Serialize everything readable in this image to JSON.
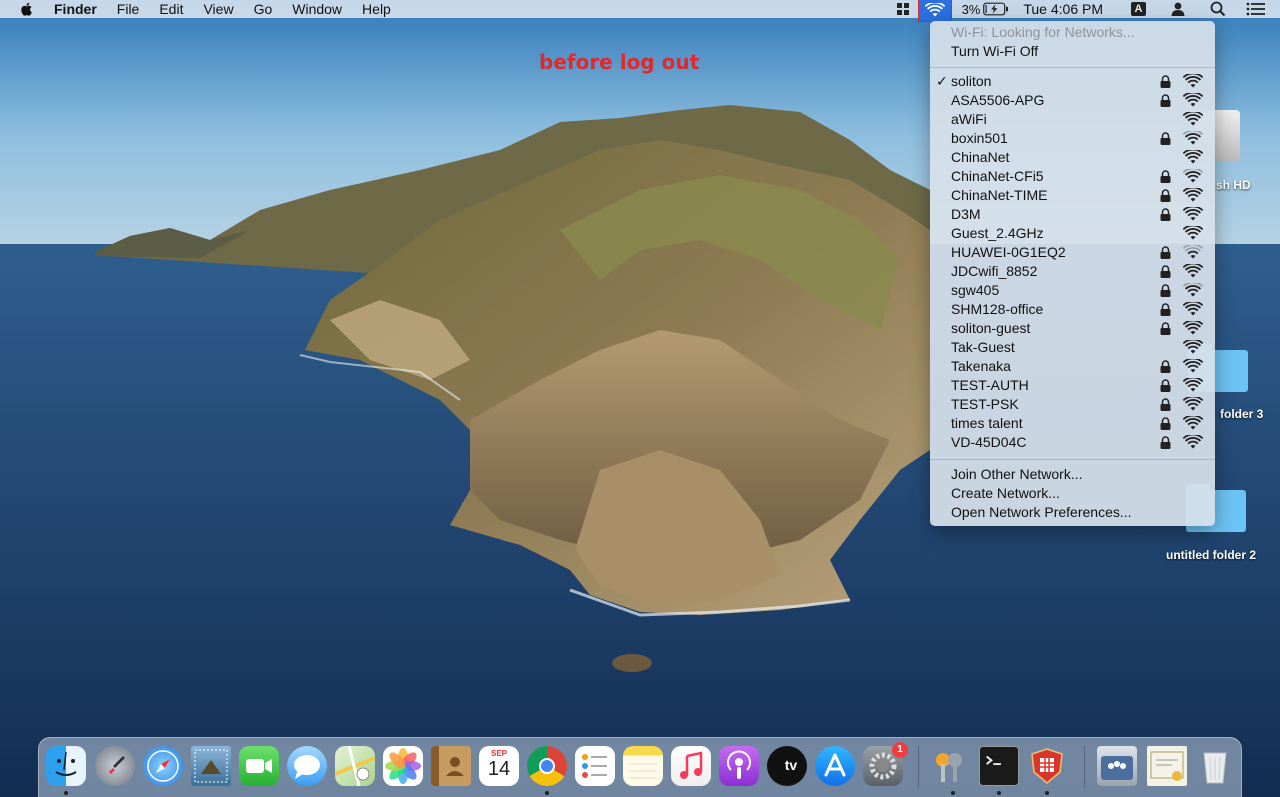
{
  "menubar": {
    "app_name": "Finder",
    "items": [
      "File",
      "Edit",
      "View",
      "Go",
      "Window",
      "Help"
    ],
    "battery_percent": "3%",
    "clock": "Tue 4:06 PM",
    "input_source": "A",
    "icons": [
      "apple-icon",
      "shortcut-icon",
      "wifi-icon",
      "battery-charging-icon",
      "input-source-icon",
      "user-icon",
      "spotlight-icon",
      "notification-center-icon"
    ]
  },
  "annotation": {
    "text": "before log out",
    "color": "#e0292c"
  },
  "wifi_menu": {
    "status": "Wi-Fi: Looking for Networks...",
    "toggle": "Turn Wi-Fi Off",
    "networks": [
      {
        "name": "soliton",
        "checked": true,
        "locked": true,
        "bars": 3
      },
      {
        "name": "ASA5506-APG",
        "checked": false,
        "locked": true,
        "bars": 3
      },
      {
        "name": "aWiFi",
        "checked": false,
        "locked": false,
        "bars": 3
      },
      {
        "name": "boxin501",
        "checked": false,
        "locked": true,
        "bars": 2
      },
      {
        "name": "ChinaNet",
        "checked": false,
        "locked": false,
        "bars": 3
      },
      {
        "name": "ChinaNet-CFi5",
        "checked": false,
        "locked": true,
        "bars": 2
      },
      {
        "name": "ChinaNet-TIME",
        "checked": false,
        "locked": true,
        "bars": 3
      },
      {
        "name": "D3M",
        "checked": false,
        "locked": true,
        "bars": 3
      },
      {
        "name": "Guest_2.4GHz",
        "checked": false,
        "locked": false,
        "bars": 3
      },
      {
        "name": "HUAWEI-0G1EQ2",
        "checked": false,
        "locked": true,
        "bars": 1
      },
      {
        "name": "JDCwifi_8852",
        "checked": false,
        "locked": true,
        "bars": 3
      },
      {
        "name": "sgw405",
        "checked": false,
        "locked": true,
        "bars": 2
      },
      {
        "name": "SHM128-office",
        "checked": false,
        "locked": true,
        "bars": 3
      },
      {
        "name": "soliton-guest",
        "checked": false,
        "locked": true,
        "bars": 3
      },
      {
        "name": "Tak-Guest",
        "checked": false,
        "locked": false,
        "bars": 3
      },
      {
        "name": "Takenaka",
        "checked": false,
        "locked": true,
        "bars": 3
      },
      {
        "name": "TEST-AUTH",
        "checked": false,
        "locked": true,
        "bars": 3
      },
      {
        "name": "TEST-PSK",
        "checked": false,
        "locked": true,
        "bars": 3
      },
      {
        "name": "times talent",
        "checked": false,
        "locked": true,
        "bars": 3
      },
      {
        "name": "VD-45D04C",
        "checked": false,
        "locked": true,
        "bars": 3
      }
    ],
    "actions": [
      "Join Other Network...",
      "Create Network...",
      "Open Network Preferences..."
    ]
  },
  "desktop": {
    "items": [
      {
        "label": "sh HD",
        "icon": "hard-disk-icon"
      },
      {
        "label": "folder 3",
        "icon": "folder-icon"
      },
      {
        "label": "untitled folder 2",
        "icon": "folder-icon"
      }
    ]
  },
  "dock": {
    "calendar_month": "SEP",
    "calendar_day": "14",
    "settings_badge": "1",
    "apps": [
      "finder-icon",
      "launchpad-icon",
      "safari-icon",
      "mail-icon",
      "facetime-icon",
      "messages-icon",
      "maps-icon",
      "photos-icon",
      "contacts-icon",
      "calendar-icon",
      "chrome-icon",
      "reminders-icon",
      "notes-icon",
      "music-icon",
      "podcasts-icon",
      "apple-tv-icon",
      "app-store-icon",
      "system-preferences-icon",
      "keychain-icon",
      "terminal-icon",
      "security-shield-icon",
      "migration-icon",
      "certificate-icon",
      "trash-icon"
    ],
    "tv_label": "tv"
  }
}
